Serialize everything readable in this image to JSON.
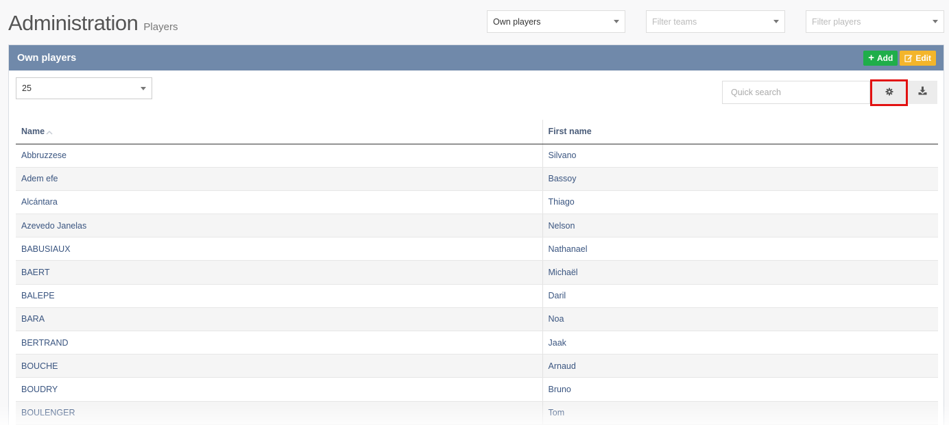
{
  "header": {
    "title": "Administration",
    "subtitle": "Players"
  },
  "filters": {
    "scope": {
      "value": "Own players"
    },
    "teams": {
      "placeholder": "Filter teams"
    },
    "players": {
      "placeholder": "Filter players"
    }
  },
  "panel": {
    "title": "Own players",
    "add_label": "Add",
    "edit_label": "Edit",
    "page_size": "25",
    "search_placeholder": "Quick search",
    "highlight_color": "#e21111"
  },
  "table": {
    "columns": {
      "name": "Name",
      "first_name": "First name"
    },
    "sort": {
      "column": "name",
      "direction": "ascending"
    },
    "rows": [
      {
        "name": "Abbruzzese",
        "first_name": "Silvano"
      },
      {
        "name": "Adem efe",
        "first_name": "Bassoy"
      },
      {
        "name": "Alcántara",
        "first_name": "Thiago"
      },
      {
        "name": "Azevedo Janelas",
        "first_name": "Nelson"
      },
      {
        "name": "BABUSIAUX",
        "first_name": "Nathanael"
      },
      {
        "name": "BAERT",
        "first_name": "Michaël"
      },
      {
        "name": "BALEPE",
        "first_name": "Daril"
      },
      {
        "name": "BARA",
        "first_name": "Noa"
      },
      {
        "name": "BERTRAND",
        "first_name": "Jaak"
      },
      {
        "name": "BOUCHE",
        "first_name": "Arnaud"
      },
      {
        "name": "BOUDRY",
        "first_name": "Bruno"
      },
      {
        "name": "BOULENGER",
        "first_name": "Tom"
      }
    ]
  },
  "colors": {
    "panel_header": "#7089aa",
    "add_button": "#1fae4a",
    "edit_button": "#f3b52b",
    "link_text": "#3a5580"
  }
}
